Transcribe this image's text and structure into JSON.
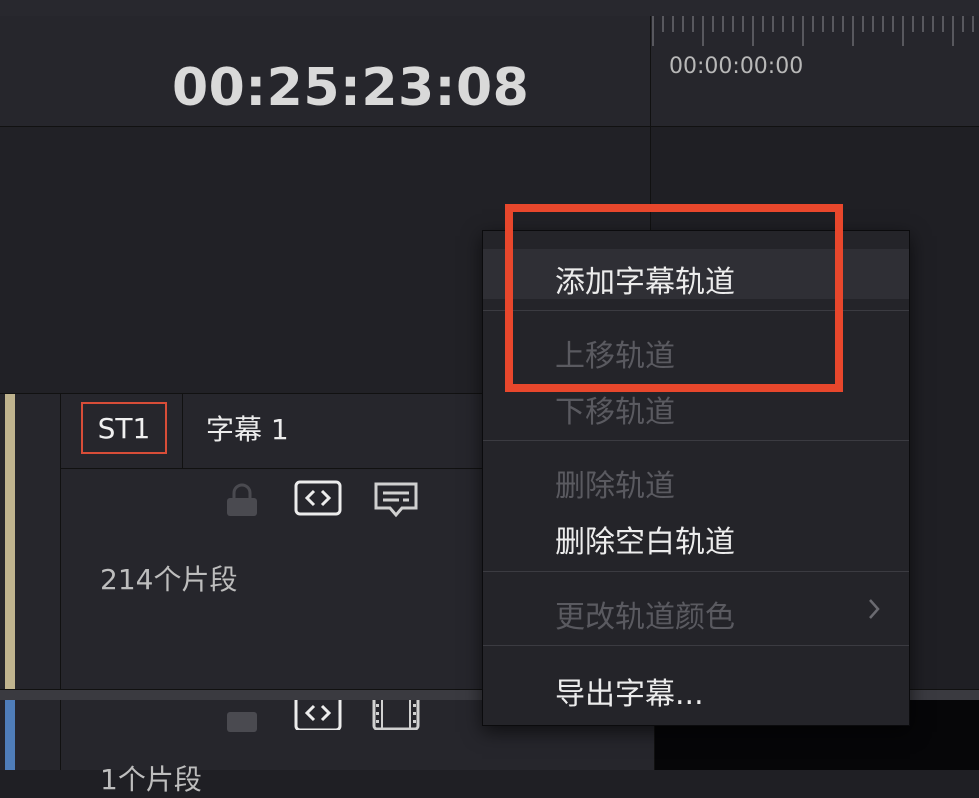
{
  "timecode": {
    "current": "00:25:23:08"
  },
  "ruler": {
    "start_timecode": "00:00:00:00"
  },
  "tracks": [
    {
      "badge": "ST1",
      "name": "字幕 1",
      "clip_count": "214个片段",
      "color": "#bfb38e",
      "icons": [
        "lock-icon",
        "code-icon",
        "caption-icon"
      ]
    },
    {
      "clip_count": "1个片段",
      "color": "#4f7db8",
      "icons": [
        "lock-icon",
        "code-icon",
        "film-icon"
      ]
    }
  ],
  "context_menu": {
    "items": [
      {
        "label": "添加字幕轨道",
        "enabled": true
      },
      {
        "label": "上移轨道",
        "enabled": false
      },
      {
        "label": "下移轨道",
        "enabled": false
      },
      {
        "label": "删除轨道",
        "enabled": false
      },
      {
        "label": "删除空白轨道",
        "enabled": true
      },
      {
        "label": "更改轨道颜色",
        "enabled": false,
        "submenu_icon": "chevron-right-icon"
      },
      {
        "label": "导出字幕...",
        "enabled": true
      }
    ]
  },
  "colors": {
    "highlight": "#e8472c",
    "badge_border": "#d84d38"
  }
}
